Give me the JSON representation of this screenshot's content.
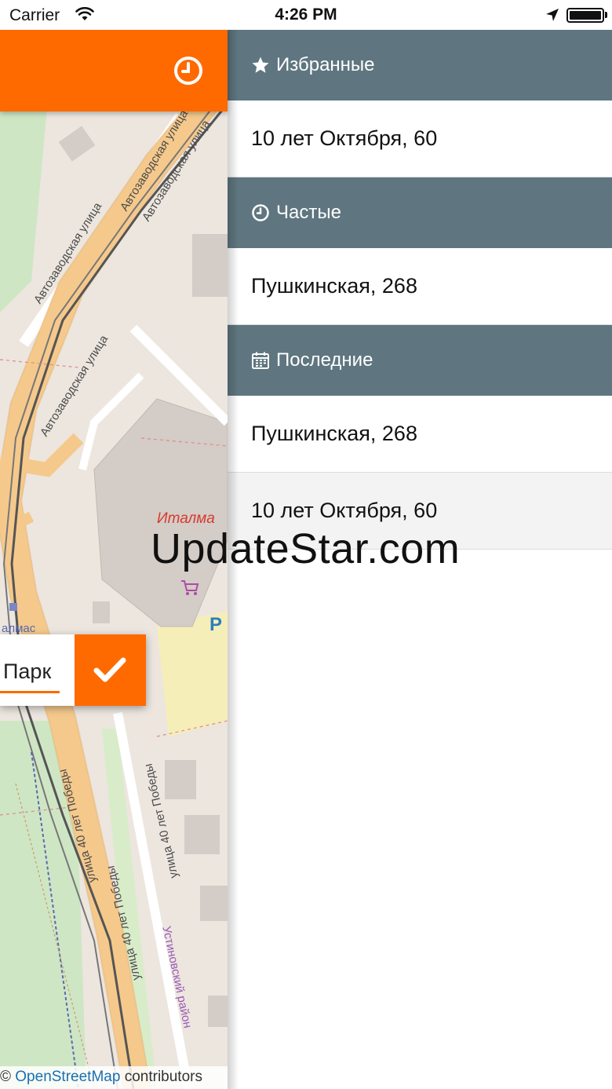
{
  "status_bar": {
    "carrier": "Carrier",
    "time": "4:26 PM",
    "wifi_icon": "wifi-icon",
    "location_icon": "location-arrow-icon",
    "battery_level": 1.0
  },
  "map": {
    "header_icon": "clock-icon",
    "street_labels": [
      "Автозаводская улица",
      "Автозаводская улица",
      "Автозаводская улица",
      "Автозаводская улица",
      "улица 40 лет Победы",
      "улица 40 лет Победы",
      "улица 40 лет Победы"
    ],
    "poi_label": "Италма",
    "station_label": "алмас",
    "district_label": "Устиновский район",
    "parking_label": "P",
    "shop_icon": "shopping-cart-icon",
    "search_value": "Парк",
    "confirm_icon": "checkmark-icon",
    "attribution": {
      "prefix": "©",
      "link": "OpenStreetMap",
      "suffix": "contributors"
    }
  },
  "favorites": {
    "sections": [
      {
        "title": "Избранные",
        "icon": "star-icon",
        "items": [
          "10 лет Октября, 60"
        ]
      },
      {
        "title": "Частые",
        "icon": "clock-icon",
        "items": [
          "Пушкинская, 268"
        ]
      },
      {
        "title": "Последние",
        "icon": "calendar-icon",
        "items": [
          "Пушкинская, 268",
          "10 лет Октября, 60"
        ]
      }
    ]
  },
  "watermark": "UpdateStar.com",
  "colors": {
    "accent": "#ff6a00",
    "section_header": "#5f7680",
    "map_background": "#ece6df",
    "road": "#f5c98c"
  }
}
